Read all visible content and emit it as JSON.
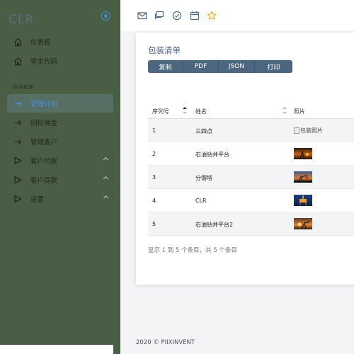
{
  "brand": {
    "name": "CLR"
  },
  "sidebar": {
    "items_top": [
      {
        "label": "仪表板",
        "icon": "home-icon"
      },
      {
        "label": "奖金代码",
        "icon": "home-icon"
      }
    ],
    "section_label": "应用程序",
    "items_app": [
      {
        "label": "管理计划",
        "icon": "arrow-right-icon",
        "active": true
      },
      {
        "label": "回扣佣金",
        "icon": "arrow-right-icon"
      },
      {
        "label": "管理客户",
        "icon": "arrow-right-icon"
      },
      {
        "label": "客户付款",
        "icon": "play-icon",
        "expandable": true
      },
      {
        "label": "客户提款",
        "icon": "play-icon",
        "expandable": true
      },
      {
        "label": "设置",
        "icon": "play-icon",
        "expandable": true
      }
    ]
  },
  "topbar": {
    "icons": [
      "mail-icon",
      "chat-icon",
      "check-circle-icon",
      "calendar-icon",
      "star-icon"
    ]
  },
  "card": {
    "title": "包装清单",
    "buttons": [
      "复制",
      "PDF",
      "JSON",
      "打印"
    ],
    "table": {
      "headers": [
        "序列号",
        "姓名",
        "照片"
      ],
      "rows": [
        {
          "id": "1",
          "name": "三四点",
          "photo": "broken",
          "alt": "包装照片"
        },
        {
          "id": "2",
          "name": "石油钻井平台",
          "photo": "oil-rig-sunset"
        },
        {
          "id": "3",
          "name": "分馏塔",
          "photo": "pumpjack-dusk"
        },
        {
          "id": "4",
          "name": "CLR",
          "photo": "offshore-platform"
        },
        {
          "id": "5",
          "name": "石油钻井平台2",
          "photo": "pumpjack-sunset"
        }
      ]
    },
    "summary": "显示 1 到 5 个条目，共 5 个条目"
  },
  "footer": {
    "text": "2020 © PIIXINVENT"
  },
  "colors": {
    "sidebar": "#4a5e46",
    "accent": "#4a90d9",
    "button": "#4d6680",
    "title": "#4b5f8a"
  }
}
